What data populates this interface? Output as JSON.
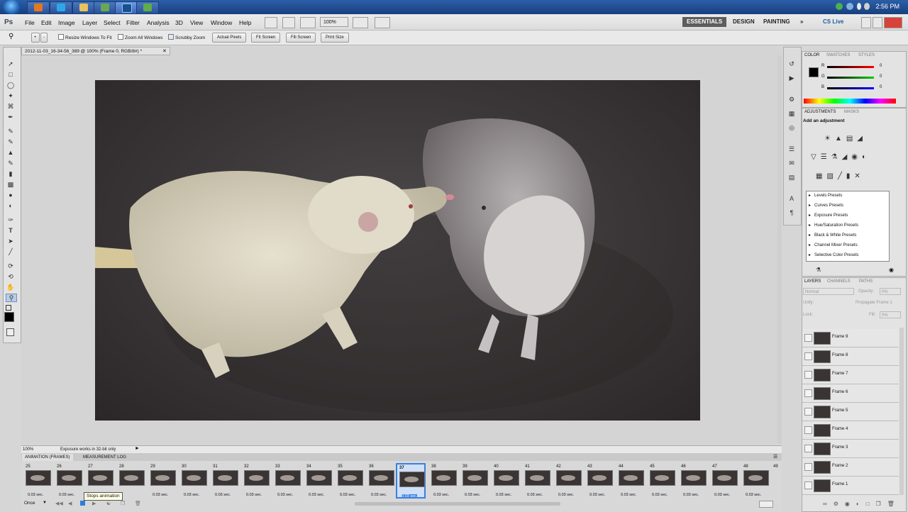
{
  "taskbar": {
    "clock": "2:56 PM"
  },
  "menubar": {
    "logo": "Ps",
    "items": [
      "File",
      "Edit",
      "Image",
      "Layer",
      "Select",
      "Filter",
      "Analysis",
      "3D",
      "View",
      "Window",
      "Help"
    ],
    "zoom": "100%",
    "workspaces": [
      "ESSENTIALS",
      "DESIGN",
      "PAINTING"
    ],
    "more": "»",
    "cslive": "CS Live"
  },
  "options": {
    "resize_windows": "Resize Windows To Fit",
    "zoom_all": "Zoom All Windows",
    "scrubby": "Scrubby Zoom",
    "buttons": [
      "Actual Pixels",
      "Fit Screen",
      "Fill Screen",
      "Print Size"
    ]
  },
  "document": {
    "tab_title": "2012-11-03_16-34-56_389 @ 100% (Frame 0, RGB/8#) *",
    "status_zoom": "100%",
    "status_text": "Exposure works in 32-bit only"
  },
  "animation": {
    "tabs": [
      "ANIMATION (FRAMES)",
      "MEASUREMENT LOG"
    ],
    "frames": [
      "25",
      "26",
      "27",
      "28",
      "29",
      "30",
      "31",
      "32",
      "33",
      "34",
      "35",
      "36",
      "37",
      "38",
      "39",
      "40",
      "41",
      "42",
      "43",
      "44",
      "45",
      "46",
      "47",
      "48",
      "49"
    ],
    "selected": "37",
    "delay": "0.03 sec.",
    "tooltip": "Stops animation",
    "loop": "Once"
  },
  "color_panel": {
    "tabs": [
      "COLOR",
      "SWATCHES",
      "STYLES"
    ],
    "channels": [
      "R",
      "G",
      "B"
    ],
    "values": [
      "0",
      "0",
      "0"
    ]
  },
  "adjustments": {
    "tabs": [
      "ADJUSTMENTS",
      "MASKS"
    ],
    "heading": "Add an adjustment",
    "presets": [
      "Levels Presets",
      "Curves Presets",
      "Exposure Presets",
      "Hue/Saturation Presets",
      "Black & White Presets",
      "Channel Mixer Presets",
      "Selective Color Presets"
    ]
  },
  "layers": {
    "tabs": [
      "LAYERS",
      "CHANNELS",
      "PATHS"
    ],
    "blend": "Normal",
    "opacity_label": "Opacity:",
    "opacity": "0%",
    "unify": "Unify:",
    "propagate": "Propagate Frame 1",
    "lock": "Lock:",
    "fill_label": "Fill:",
    "fill": "0%",
    "items": [
      "Frame 9",
      "Frame 8",
      "Frame 7",
      "Frame 6",
      "Frame 5",
      "Frame 4",
      "Frame 3",
      "Frame 2",
      "Frame 1"
    ]
  },
  "colors": {
    "accent": "#3b7fe0",
    "foreground": "#000000",
    "background": "#ffffff"
  }
}
